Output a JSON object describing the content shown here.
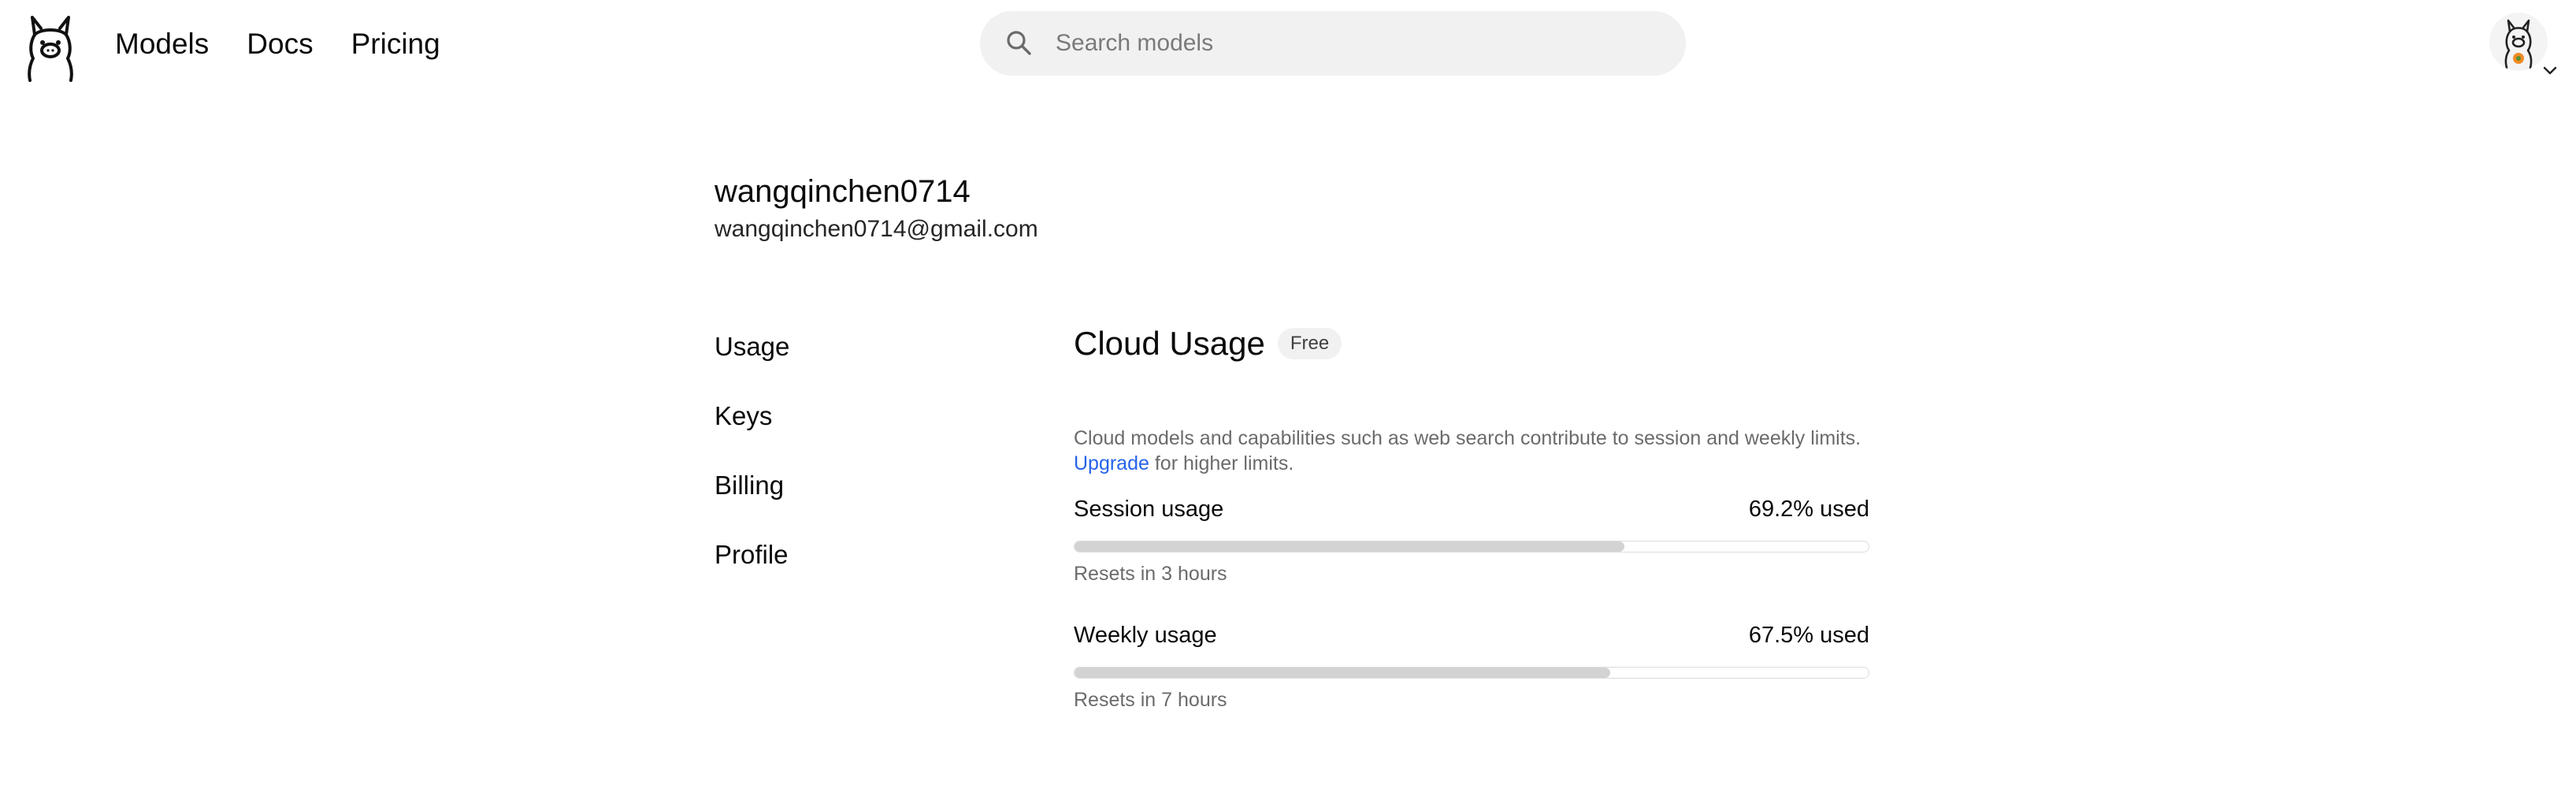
{
  "header": {
    "nav": [
      {
        "label": "Models"
      },
      {
        "label": "Docs"
      },
      {
        "label": "Pricing"
      }
    ],
    "search": {
      "placeholder": "Search models",
      "value": ""
    },
    "logo_icon": "llama-logo-icon",
    "avatar_icon": "llama-avatar-icon"
  },
  "account": {
    "username": "wangqinchen0714",
    "email": "wangqinchen0714@gmail.com"
  },
  "sidebar": {
    "items": [
      {
        "label": "Usage"
      },
      {
        "label": "Keys"
      },
      {
        "label": "Billing"
      },
      {
        "label": "Profile"
      }
    ]
  },
  "main": {
    "title": "Cloud Usage",
    "plan_badge": "Free",
    "description_prefix": "Cloud models and capabilities such as web search contribute to session and weekly limits.",
    "upgrade_link": "Upgrade",
    "description_suffix": "for higher limits.",
    "usage": [
      {
        "label": "Session usage",
        "value_text": "69.2% used",
        "fraction": 0.692,
        "reset": "Resets in 3 hours"
      },
      {
        "label": "Weekly usage",
        "value_text": "67.5% used",
        "fraction": 0.675,
        "reset": "Resets in 7 hours"
      }
    ]
  },
  "colors": {
    "link": "#2563eb",
    "bar_fill": "#d3d3d3",
    "bar_border": "#dcdcdc",
    "search_bg": "#f1f1f1",
    "muted_text": "#6b6b6b"
  }
}
